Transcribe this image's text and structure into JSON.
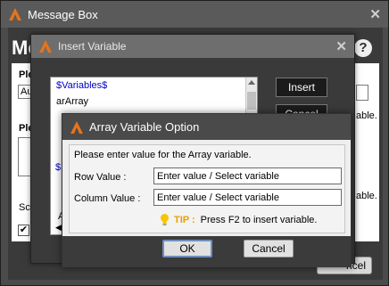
{
  "message_box": {
    "title": "Message Box",
    "heading": "Me",
    "help_icon": "?",
    "label_1": "Ple",
    "field_1_value": "Au",
    "label_2": "Ple",
    "fragment_able_1": "able.",
    "fragment_able_2": "able.",
    "label_sc": "Sc",
    "checkbox_mark": "✔",
    "cancel_label": "ncel"
  },
  "insert_variable": {
    "title": "Insert Variable",
    "list_items": [
      "$Variables$",
      "arArray"
    ],
    "list_fragment_1": "$",
    "list_fragment_2": "A",
    "insert_label": "Insert",
    "cancel_label": "Cancel"
  },
  "array_option": {
    "title": "Array Variable Option",
    "prompt": "Please enter value for the  Array variable.",
    "row_label": "Row Value :",
    "row_placeholder": "Enter value / Select variable",
    "column_label": "Column Value :",
    "column_placeholder": "Enter value / Select variable",
    "tip_label": "TIP :",
    "tip_text": "Press F2 to insert variable.",
    "ok_label": "OK",
    "cancel_label": "Cancel"
  },
  "icons": {
    "app_logo": "app-logo-icon",
    "close": "close-icon",
    "help": "help-icon",
    "tip": "lightbulb-icon"
  },
  "colors": {
    "title_dark": "#4a4a4a",
    "selected_item": "#0000cc",
    "tip_accent": "#e6a200"
  }
}
